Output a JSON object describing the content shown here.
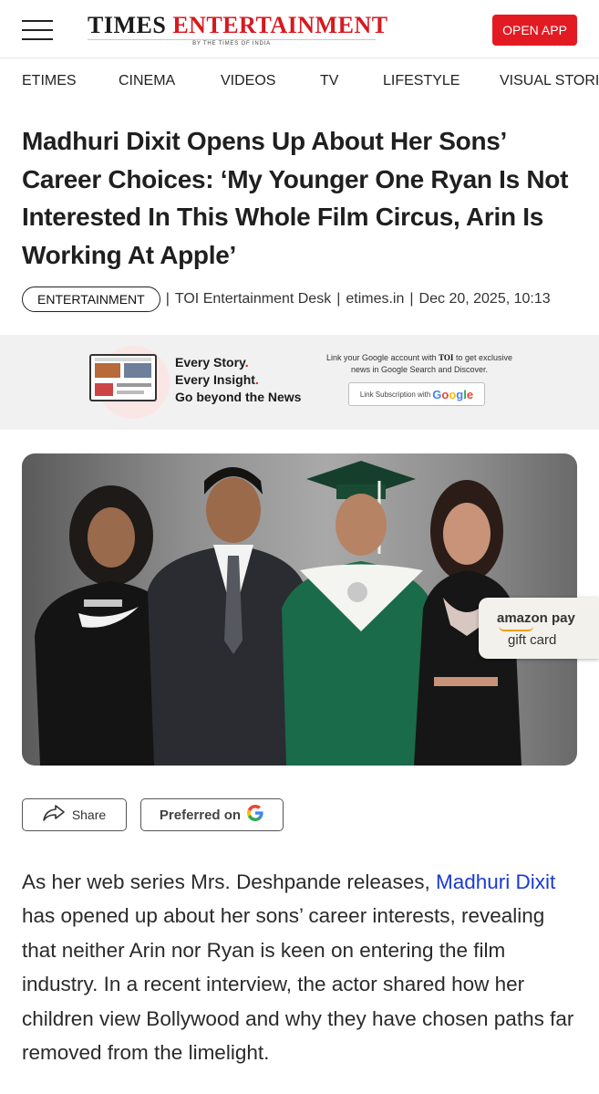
{
  "header": {
    "logo_times": "TIMES",
    "logo_entertainment": "ENTERTAINMENT",
    "logo_tagline": "BY THE TIMES OF INDIA",
    "open_app_label": "OPEN APP",
    "menu_icon": "hamburger-menu-icon"
  },
  "nav": {
    "items": [
      "ETIMES",
      "CINEMA",
      "VIDEOS",
      "TV",
      "LIFESTYLE",
      "VISUAL STORI"
    ]
  },
  "article": {
    "title": "Madhuri Dixit Opens Up About Her Sons’ Career Choices: ‘My Younger One Ryan Is Not Interested In This Whole Film Circus, Arin Is Working At Apple’",
    "tag": "ENTERTAINMENT",
    "separator": "|",
    "author": "TOI Entertainment Desk",
    "source": "etimes.in",
    "date": "Dec 20, 2025, 10:13",
    "body_before_link": "As her web series Mrs. Deshpande releases, ",
    "body_link": "Madhuri Dixit",
    "body_after_link": " has opened up about her sons’ career interests, revealing that neither Arin nor Ryan is keen on entering the film industry. In a recent interview, the actor shared how her children view Bollywood and why they have chosen paths far removed from the limelight."
  },
  "promo": {
    "line1": "Every Story",
    "line2": "Every Insight",
    "line3": "Go beyond the News",
    "dot": ".",
    "desc_before": "Link your Google account with ",
    "desc_brand": "TOI",
    "desc_after": " to get exclusive news in Google Search and Discover.",
    "button_label": "Link Subscription with",
    "button_brand": "Google"
  },
  "ad": {
    "line1": "amazon pay",
    "line2": "gift card"
  },
  "actions": {
    "share_label": "Share",
    "preferred_label": "Preferred on",
    "preferred_icon": "google-g-icon"
  },
  "colors": {
    "brand_red": "#e21b23",
    "link_blue": "#1a3bd1",
    "amazon_orange": "#f29b1d"
  }
}
